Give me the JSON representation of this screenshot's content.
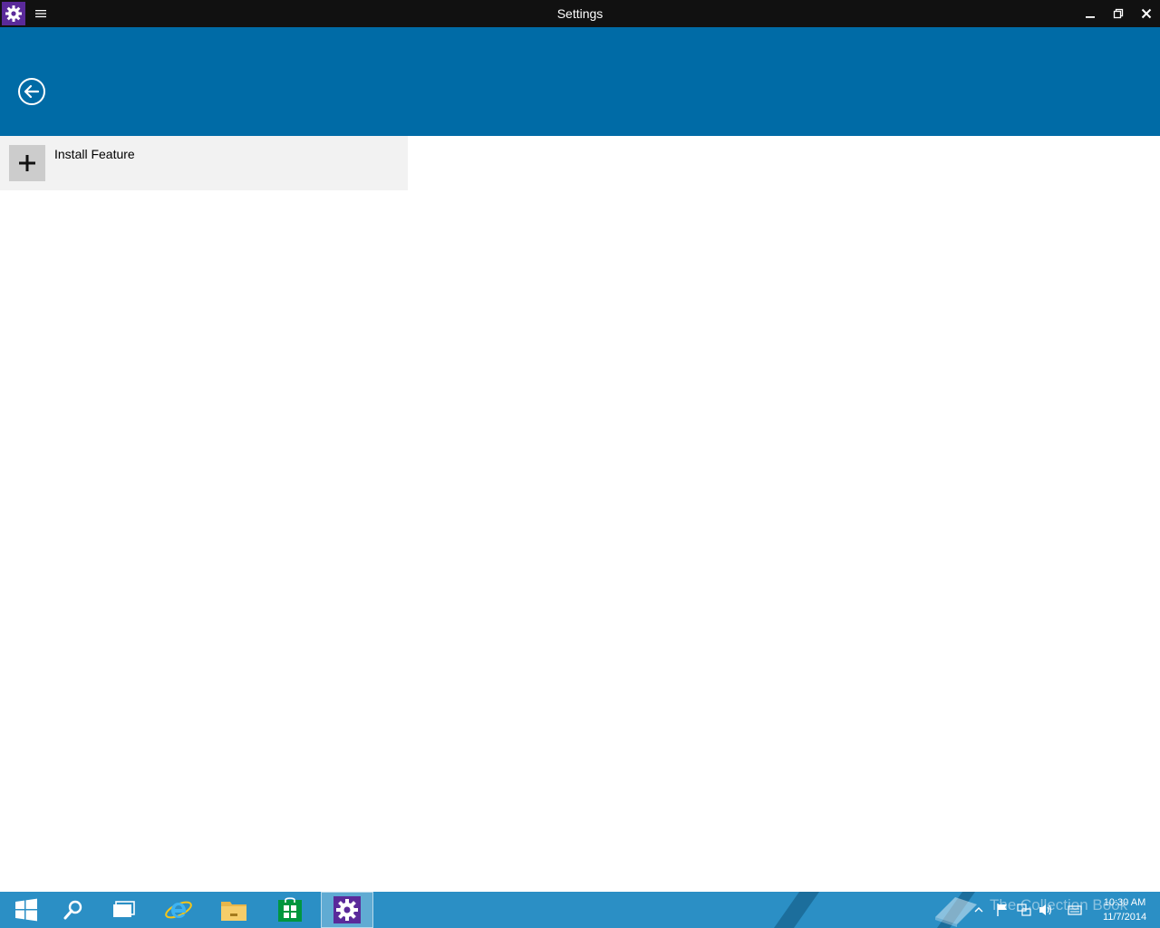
{
  "window": {
    "title": "Settings"
  },
  "content": {
    "items": [
      {
        "label": "Install Feature",
        "icon": "plus-icon"
      }
    ]
  },
  "taskbar": {
    "apps": [
      {
        "name": "start",
        "icon": "windows-logo-icon"
      },
      {
        "name": "search",
        "icon": "search-icon"
      },
      {
        "name": "task-view",
        "icon": "task-view-icon"
      },
      {
        "name": "internet-explorer",
        "icon": "internet-explorer-icon"
      },
      {
        "name": "file-explorer",
        "icon": "folder-icon"
      },
      {
        "name": "store",
        "icon": "store-icon"
      },
      {
        "name": "settings",
        "icon": "gear-icon",
        "active": true
      }
    ],
    "watermark": "The Collection Book",
    "tray": {
      "time": "10:30 AM",
      "date": "11/7/2014"
    }
  },
  "colors": {
    "titlebar": "#111111",
    "header": "#006ba6",
    "list_item_bg": "#f2f2f2",
    "taskbar": "#2b8fc5",
    "app_icon_bg": "#5a2a9a"
  }
}
